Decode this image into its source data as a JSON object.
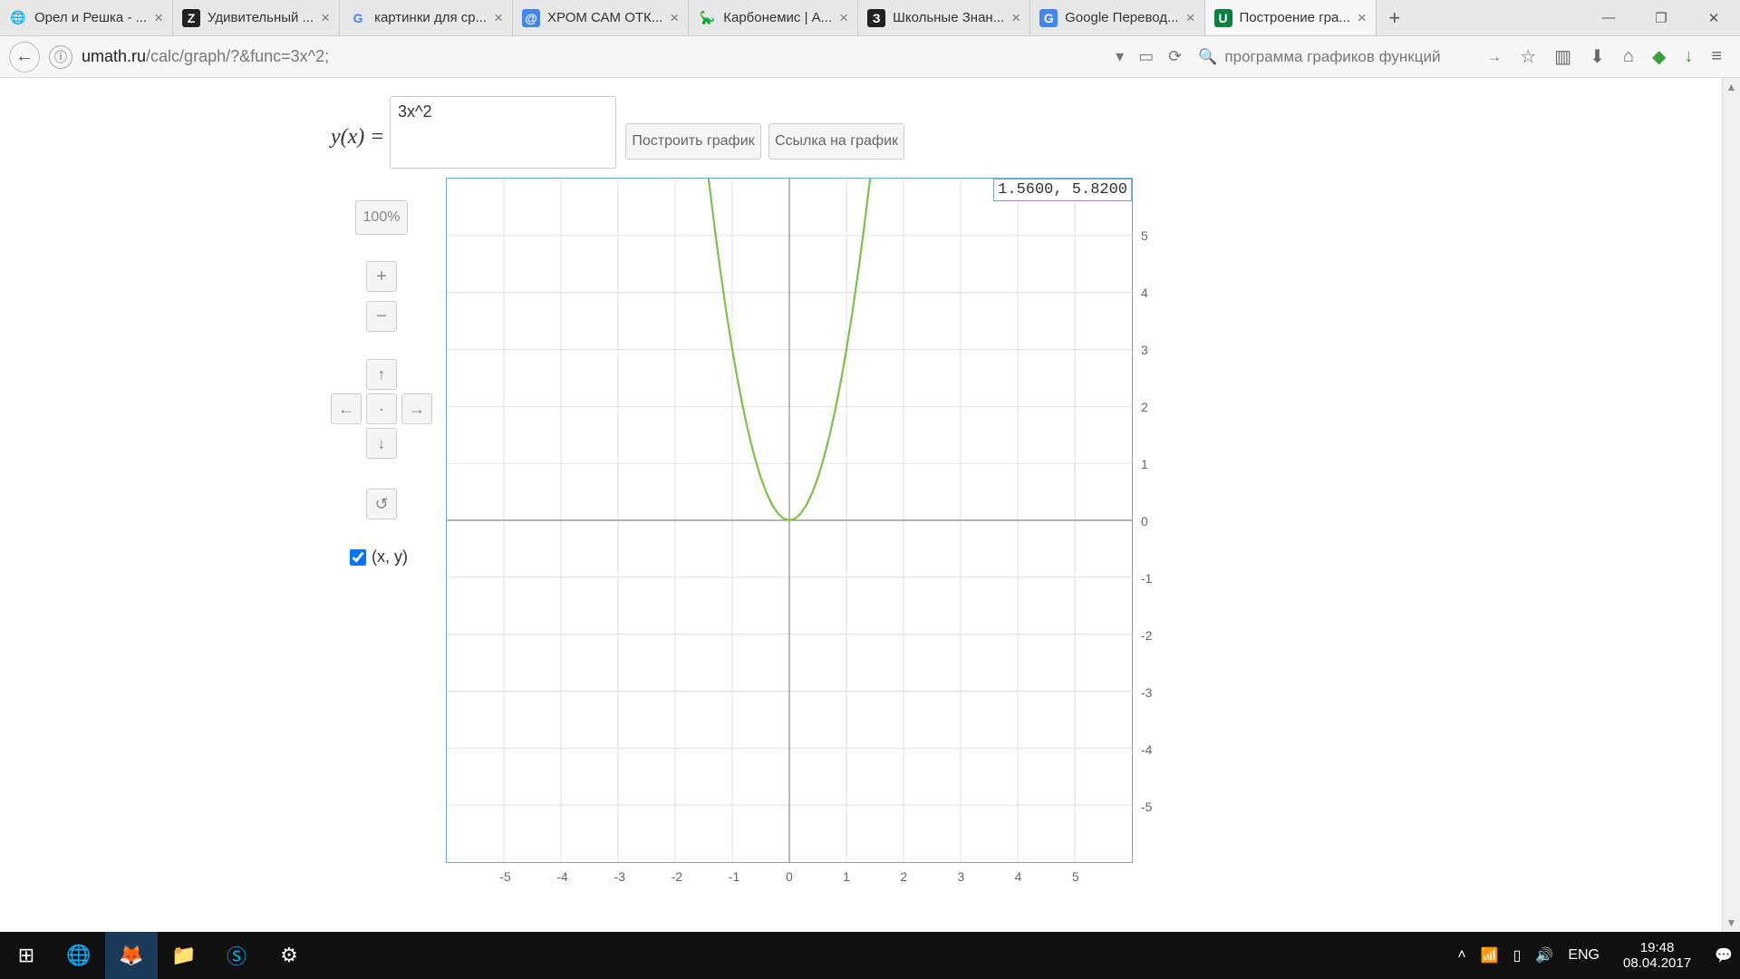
{
  "browser": {
    "tabs": [
      {
        "label": "Орел и Решка - ..."
      },
      {
        "label": "Удивительный ..."
      },
      {
        "label": "картинки для ср..."
      },
      {
        "label": "ХРОМ САМ ОТК..."
      },
      {
        "label": "Карбонемис | А..."
      },
      {
        "label": "Школьные Знан..."
      },
      {
        "label": "Google Перевод..."
      },
      {
        "label": "Построение гра...",
        "active": true
      }
    ],
    "url_host": "umath.ru",
    "url_path": "/calc/graph/?&func=3x^2;",
    "search_value": "программа графиков функций"
  },
  "app": {
    "formula_prefix": "y(x) =",
    "function_input": "3x^2",
    "plot_button": "Построить график",
    "link_button": "Ссылка на график",
    "zoom_label": "100%",
    "xy_label": "(x, y)",
    "coord_readout": "1.5600, 5.8200"
  },
  "chart_data": {
    "type": "line",
    "title": "",
    "xlabel": "",
    "ylabel": "",
    "xlim": [
      -6,
      6
    ],
    "ylim": [
      -6,
      6
    ],
    "x_ticks": [
      -5,
      -4,
      -3,
      -2,
      -1,
      0,
      1,
      2,
      3,
      4,
      5
    ],
    "y_ticks": [
      -5,
      -4,
      -3,
      -2,
      -1,
      0,
      1,
      2,
      3,
      4,
      5
    ],
    "series": [
      {
        "name": "3x^2",
        "color": "#7cc24a",
        "x": [
          -1.414,
          -1.3,
          -1.2,
          -1.1,
          -1.0,
          -0.9,
          -0.8,
          -0.7,
          -0.6,
          -0.5,
          -0.4,
          -0.3,
          -0.2,
          -0.1,
          0,
          0.1,
          0.2,
          0.3,
          0.4,
          0.5,
          0.6,
          0.7,
          0.8,
          0.9,
          1.0,
          1.1,
          1.2,
          1.3,
          1.414
        ],
        "values": [
          6.0,
          5.07,
          4.32,
          3.63,
          3.0,
          2.43,
          1.92,
          1.47,
          1.08,
          0.75,
          0.48,
          0.27,
          0.12,
          0.03,
          0,
          0.03,
          0.12,
          0.27,
          0.48,
          0.75,
          1.08,
          1.47,
          1.92,
          2.43,
          3.0,
          3.63,
          4.32,
          5.07,
          6.0
        ]
      }
    ]
  },
  "taskbar": {
    "lang": "ENG",
    "time": "19:48",
    "date": "08.04.2017"
  }
}
